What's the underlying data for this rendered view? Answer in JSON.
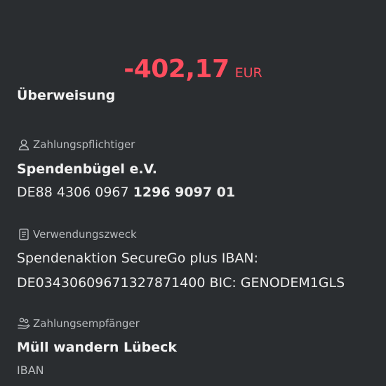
{
  "transaction": {
    "amount": "-402,17",
    "currency": "EUR",
    "type": "Überweisung"
  },
  "payer": {
    "label": "Zahlungspflichtiger",
    "icon": "person-icon",
    "name": "Spendenbügel e.V.",
    "iban_prefix": "DE88 4306 0967",
    "iban_suffix": "1296 9097 01"
  },
  "purpose": {
    "label": "Verwendungszweck",
    "icon": "document-icon",
    "line1": "Spendenaktion SecureGo plus IBAN:",
    "line2": "DE03430609671327871400 BIC: GENODEM1GLS"
  },
  "recipient": {
    "label": "Zahlungsempfänger",
    "icon": "hand-coins-icon",
    "name": "Müll wandern Lübeck",
    "iban_label": "IBAN"
  },
  "colors": {
    "background": "#2a2d30",
    "amount": "#ff4d5e",
    "primary_text": "#f1f1f1",
    "secondary_text": "#b8bbbe"
  }
}
